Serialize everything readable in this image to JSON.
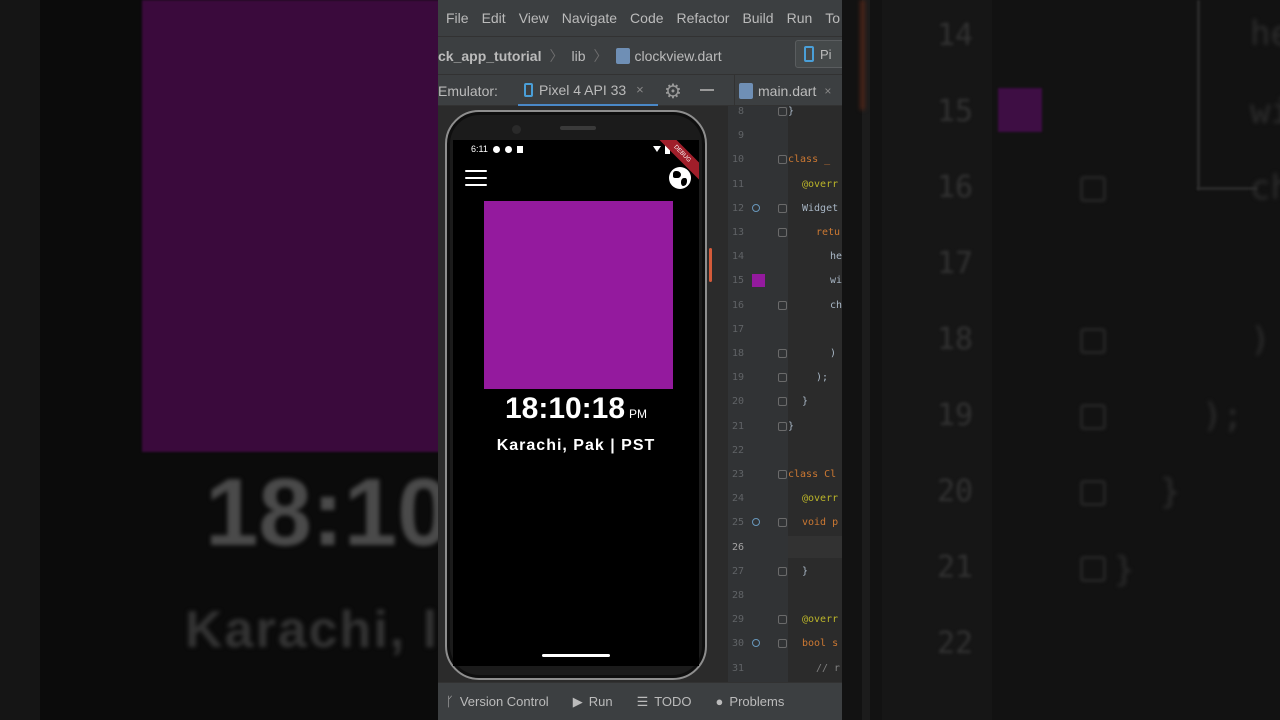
{
  "menu": [
    "File",
    "Edit",
    "View",
    "Navigate",
    "Code",
    "Refactor",
    "Build",
    "Run",
    "To"
  ],
  "breadcrumb": {
    "project": "ck_app_tutorial",
    "folder": "lib",
    "file": "clockview.dart",
    "device_short": "Pi"
  },
  "emulator": {
    "label": "Emulator:",
    "device_tab": "Pixel 4 API 33",
    "close": "×"
  },
  "editor_tab": {
    "label": "main.dart",
    "close": "×"
  },
  "phone": {
    "status_time": "6:11",
    "debug_banner": "DEBUG",
    "clock_time": "18:10:18",
    "ampm": "PM",
    "city": "Karachi, Pak | PST",
    "box_color": "#941a9e"
  },
  "code": {
    "line_numbers": [
      "8",
      "9",
      "10",
      "11",
      "12",
      "13",
      "14",
      "15",
      "16",
      "17",
      "18",
      "19",
      "20",
      "21",
      "22",
      "23",
      "24",
      "25",
      "26",
      "27",
      "28",
      "29",
      "30",
      "31"
    ],
    "lines": [
      {
        "n": "8",
        "text": "}",
        "cls": "plain",
        "indent": 0
      },
      {
        "n": "10",
        "text": "class _",
        "cls": "kw",
        "indent": 0
      },
      {
        "n": "11",
        "text": "@overr",
        "cls": "ann",
        "indent": 1
      },
      {
        "n": "12",
        "text": "Widget",
        "cls": "plain",
        "indent": 1
      },
      {
        "n": "13",
        "text": "retu",
        "cls": "kw",
        "indent": 2
      },
      {
        "n": "14",
        "text": "he",
        "cls": "plain",
        "indent": 3
      },
      {
        "n": "15",
        "text": "wi",
        "cls": "plain",
        "indent": 3
      },
      {
        "n": "16",
        "text": "ch",
        "cls": "plain",
        "indent": 3
      },
      {
        "n": "18",
        "text": ")",
        "cls": "plain",
        "indent": 3
      },
      {
        "n": "19",
        "text": ");",
        "cls": "plain",
        "indent": 2
      },
      {
        "n": "20",
        "text": "}",
        "cls": "plain",
        "indent": 1
      },
      {
        "n": "21",
        "text": "}",
        "cls": "plain",
        "indent": 0
      },
      {
        "n": "23",
        "text": "class Cl",
        "cls": "kw",
        "indent": 0
      },
      {
        "n": "24",
        "text": "@overr",
        "cls": "ann",
        "indent": 1
      },
      {
        "n": "25",
        "text": "void p",
        "cls": "kw",
        "indent": 1
      },
      {
        "n": "27",
        "text": "}",
        "cls": "plain",
        "indent": 1
      },
      {
        "n": "29",
        "text": "@overr",
        "cls": "ann",
        "indent": 1
      },
      {
        "n": "30",
        "text": "bool s",
        "cls": "kw",
        "indent": 1
      },
      {
        "n": "31",
        "text": "// r",
        "cls": "cm",
        "indent": 2
      }
    ]
  },
  "bottom": [
    {
      "icon": "ᚴ",
      "label": "Version Control"
    },
    {
      "icon": "▶",
      "label": "Run"
    },
    {
      "icon": "☰",
      "label": "TODO"
    },
    {
      "icon": "●",
      "label": "Problems"
    }
  ],
  "background": {
    "left_time": "18:10",
    "left_city": "Karachi, l",
    "right_nums": [
      "14",
      "15",
      "16",
      "17",
      "18",
      "19",
      "20",
      "21",
      "22"
    ],
    "right_text": [
      "he",
      "wi",
      "ch",
      ")",
      ");",
      "}",
      "}"
    ]
  }
}
